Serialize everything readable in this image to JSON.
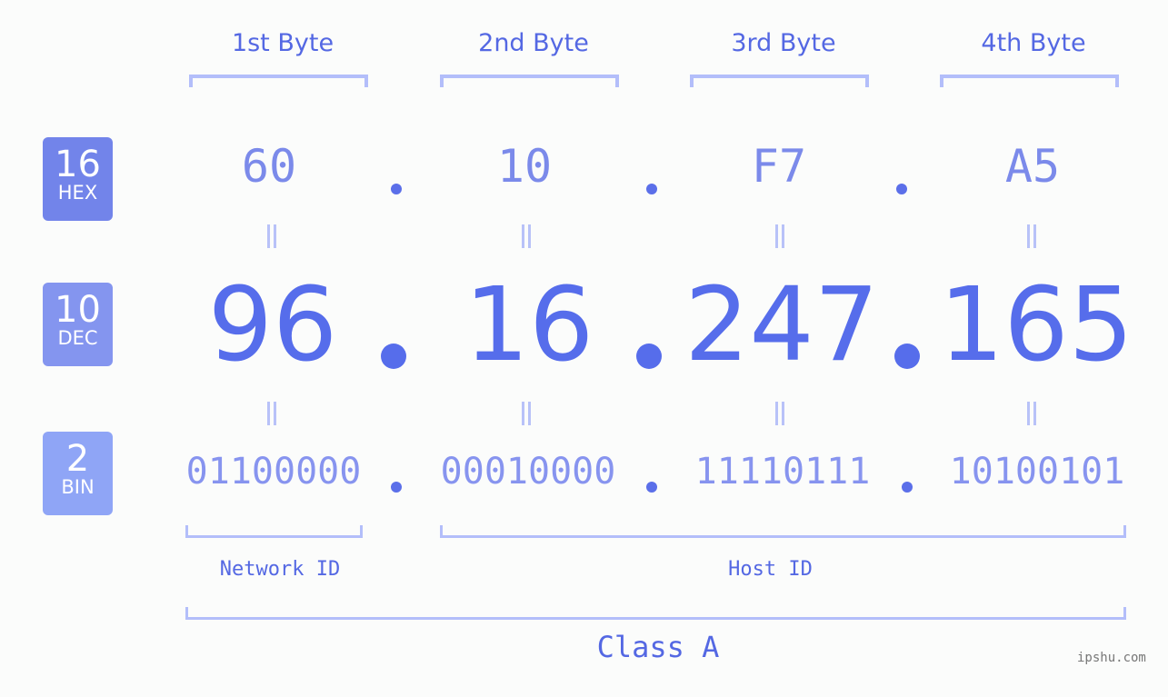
{
  "bytes": [
    {
      "label": "1st Byte",
      "hex": "60",
      "dec": "96",
      "bin": "01100000"
    },
    {
      "label": "2nd Byte",
      "hex": "10",
      "dec": "16",
      "bin": "00010000"
    },
    {
      "label": "3rd Byte",
      "hex": "F7",
      "dec": "247",
      "bin": "11110111"
    },
    {
      "label": "4th Byte",
      "hex": "A5",
      "dec": "165",
      "bin": "10100101"
    }
  ],
  "bases": {
    "hex": {
      "num": "16",
      "label": "HEX",
      "color": "#7284ea"
    },
    "dec": {
      "num": "10",
      "label": "DEC",
      "color": "#8495ef"
    },
    "bin": {
      "num": "2",
      "label": "BIN",
      "color": "#8fa5f6"
    }
  },
  "separator": ".",
  "network_label": "Network ID",
  "host_label": "Host ID",
  "class_label": "Class A",
  "watermark": "ipshu.com",
  "colors": {
    "accent": "#566deb",
    "bracket": "#b3befa",
    "background": "#fbfcfb"
  }
}
